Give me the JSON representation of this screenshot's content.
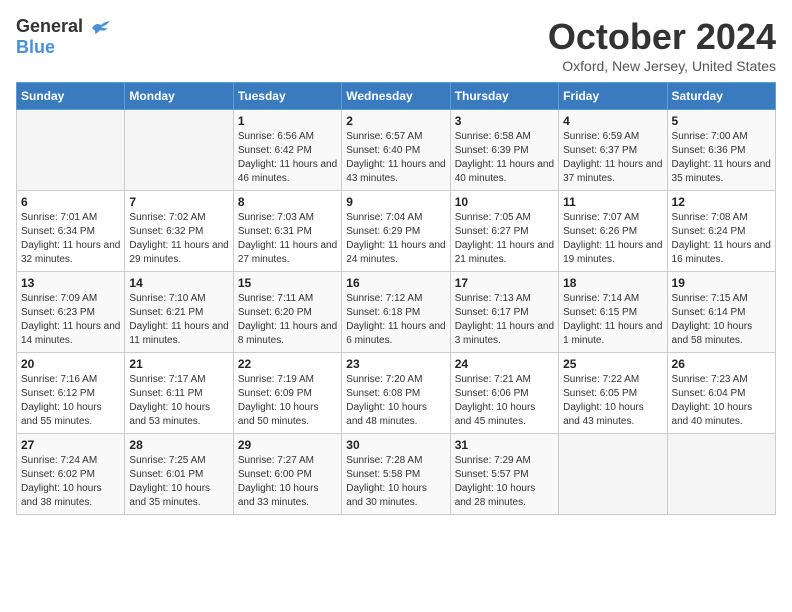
{
  "header": {
    "logo_general": "General",
    "logo_blue": "Blue",
    "title": "October 2024",
    "location": "Oxford, New Jersey, United States"
  },
  "weekdays": [
    "Sunday",
    "Monday",
    "Tuesday",
    "Wednesday",
    "Thursday",
    "Friday",
    "Saturday"
  ],
  "weeks": [
    [
      {
        "day": "",
        "content": ""
      },
      {
        "day": "",
        "content": ""
      },
      {
        "day": "1",
        "content": "Sunrise: 6:56 AM\nSunset: 6:42 PM\nDaylight: 11 hours and 46 minutes."
      },
      {
        "day": "2",
        "content": "Sunrise: 6:57 AM\nSunset: 6:40 PM\nDaylight: 11 hours and 43 minutes."
      },
      {
        "day": "3",
        "content": "Sunrise: 6:58 AM\nSunset: 6:39 PM\nDaylight: 11 hours and 40 minutes."
      },
      {
        "day": "4",
        "content": "Sunrise: 6:59 AM\nSunset: 6:37 PM\nDaylight: 11 hours and 37 minutes."
      },
      {
        "day": "5",
        "content": "Sunrise: 7:00 AM\nSunset: 6:36 PM\nDaylight: 11 hours and 35 minutes."
      }
    ],
    [
      {
        "day": "6",
        "content": "Sunrise: 7:01 AM\nSunset: 6:34 PM\nDaylight: 11 hours and 32 minutes."
      },
      {
        "day": "7",
        "content": "Sunrise: 7:02 AM\nSunset: 6:32 PM\nDaylight: 11 hours and 29 minutes."
      },
      {
        "day": "8",
        "content": "Sunrise: 7:03 AM\nSunset: 6:31 PM\nDaylight: 11 hours and 27 minutes."
      },
      {
        "day": "9",
        "content": "Sunrise: 7:04 AM\nSunset: 6:29 PM\nDaylight: 11 hours and 24 minutes."
      },
      {
        "day": "10",
        "content": "Sunrise: 7:05 AM\nSunset: 6:27 PM\nDaylight: 11 hours and 21 minutes."
      },
      {
        "day": "11",
        "content": "Sunrise: 7:07 AM\nSunset: 6:26 PM\nDaylight: 11 hours and 19 minutes."
      },
      {
        "day": "12",
        "content": "Sunrise: 7:08 AM\nSunset: 6:24 PM\nDaylight: 11 hours and 16 minutes."
      }
    ],
    [
      {
        "day": "13",
        "content": "Sunrise: 7:09 AM\nSunset: 6:23 PM\nDaylight: 11 hours and 14 minutes."
      },
      {
        "day": "14",
        "content": "Sunrise: 7:10 AM\nSunset: 6:21 PM\nDaylight: 11 hours and 11 minutes."
      },
      {
        "day": "15",
        "content": "Sunrise: 7:11 AM\nSunset: 6:20 PM\nDaylight: 11 hours and 8 minutes."
      },
      {
        "day": "16",
        "content": "Sunrise: 7:12 AM\nSunset: 6:18 PM\nDaylight: 11 hours and 6 minutes."
      },
      {
        "day": "17",
        "content": "Sunrise: 7:13 AM\nSunset: 6:17 PM\nDaylight: 11 hours and 3 minutes."
      },
      {
        "day": "18",
        "content": "Sunrise: 7:14 AM\nSunset: 6:15 PM\nDaylight: 11 hours and 1 minute."
      },
      {
        "day": "19",
        "content": "Sunrise: 7:15 AM\nSunset: 6:14 PM\nDaylight: 10 hours and 58 minutes."
      }
    ],
    [
      {
        "day": "20",
        "content": "Sunrise: 7:16 AM\nSunset: 6:12 PM\nDaylight: 10 hours and 55 minutes."
      },
      {
        "day": "21",
        "content": "Sunrise: 7:17 AM\nSunset: 6:11 PM\nDaylight: 10 hours and 53 minutes."
      },
      {
        "day": "22",
        "content": "Sunrise: 7:19 AM\nSunset: 6:09 PM\nDaylight: 10 hours and 50 minutes."
      },
      {
        "day": "23",
        "content": "Sunrise: 7:20 AM\nSunset: 6:08 PM\nDaylight: 10 hours and 48 minutes."
      },
      {
        "day": "24",
        "content": "Sunrise: 7:21 AM\nSunset: 6:06 PM\nDaylight: 10 hours and 45 minutes."
      },
      {
        "day": "25",
        "content": "Sunrise: 7:22 AM\nSunset: 6:05 PM\nDaylight: 10 hours and 43 minutes."
      },
      {
        "day": "26",
        "content": "Sunrise: 7:23 AM\nSunset: 6:04 PM\nDaylight: 10 hours and 40 minutes."
      }
    ],
    [
      {
        "day": "27",
        "content": "Sunrise: 7:24 AM\nSunset: 6:02 PM\nDaylight: 10 hours and 38 minutes."
      },
      {
        "day": "28",
        "content": "Sunrise: 7:25 AM\nSunset: 6:01 PM\nDaylight: 10 hours and 35 minutes."
      },
      {
        "day": "29",
        "content": "Sunrise: 7:27 AM\nSunset: 6:00 PM\nDaylight: 10 hours and 33 minutes."
      },
      {
        "day": "30",
        "content": "Sunrise: 7:28 AM\nSunset: 5:58 PM\nDaylight: 10 hours and 30 minutes."
      },
      {
        "day": "31",
        "content": "Sunrise: 7:29 AM\nSunset: 5:57 PM\nDaylight: 10 hours and 28 minutes."
      },
      {
        "day": "",
        "content": ""
      },
      {
        "day": "",
        "content": ""
      }
    ]
  ]
}
